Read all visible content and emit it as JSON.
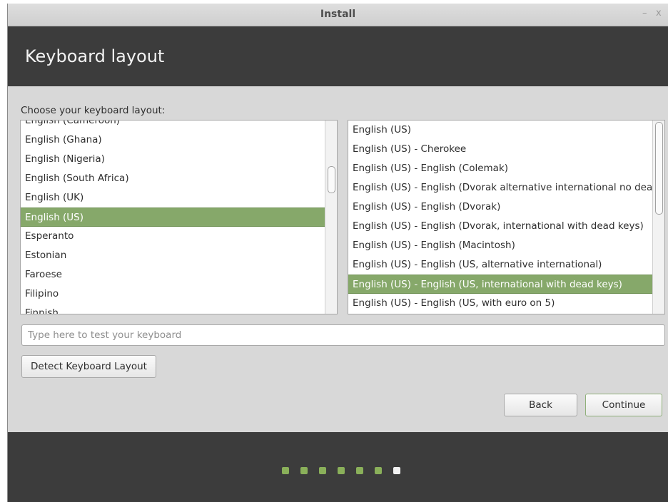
{
  "window": {
    "title": "Install",
    "minimize_glyph": "–",
    "close_glyph": "x"
  },
  "header": {
    "title": "Keyboard layout"
  },
  "main": {
    "choose_label": "Choose your keyboard layout:",
    "left_list": {
      "items": [
        "English (Cameroon)",
        "English (Ghana)",
        "English (Nigeria)",
        "English (South Africa)",
        "English (UK)",
        "English (US)",
        "Esperanto",
        "Estonian",
        "Faroese",
        "Filipino",
        "Finnish"
      ],
      "selected": "English (US)"
    },
    "right_list": {
      "items": [
        "English (US)",
        "English (US) - Cherokee",
        "English (US) - English (Colemak)",
        "English (US) - English (Dvorak alternative international no dead keys)",
        "English (US) - English (Dvorak)",
        "English (US) - English (Dvorak, international with dead keys)",
        "English (US) - English (Macintosh)",
        "English (US) - English (US, alternative international)",
        "English (US) - English (US, international with dead keys)",
        "English (US) - English (US, with euro on 5)"
      ],
      "selected": "English (US) - English (US, international with dead keys)"
    },
    "test_input": {
      "value": "",
      "placeholder": "Type here to test your keyboard"
    },
    "detect_button": "Detect Keyboard Layout",
    "back_button": "Back",
    "continue_button": "Continue"
  },
  "footer": {
    "progress": {
      "total_steps": 7,
      "current_step": 7
    }
  },
  "colors": {
    "header_bg": "#3c3c3c",
    "selection": "#86a86a",
    "progress_done": "#8ab05a",
    "progress_current": "#f2f2f2"
  }
}
